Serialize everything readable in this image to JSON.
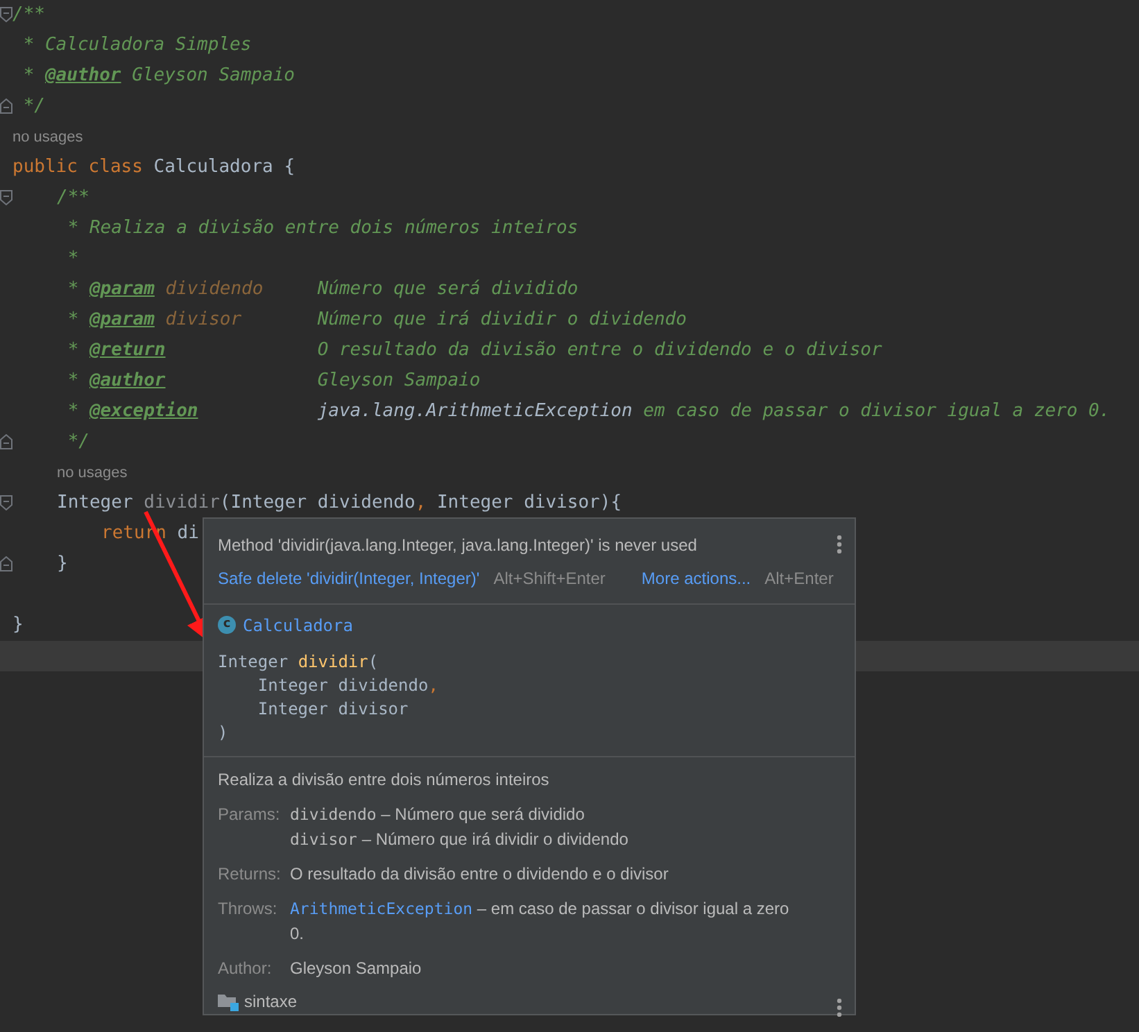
{
  "editor": {
    "lines": [
      {
        "kind": "doc_open",
        "text": "/**",
        "fold_start": true
      },
      {
        "kind": "doc_text",
        "text": "* Calculadora Simples"
      },
      {
        "kind": "doc_tag",
        "lead": "*",
        "tag": "@author",
        "description": "Gleyson Sampaio",
        "inline": true
      },
      {
        "kind": "doc_close",
        "text": "*/",
        "fold_end": true
      },
      {
        "kind": "hint",
        "text": "no usages"
      },
      {
        "kind": "code",
        "tokens": [
          {
            "text": "public",
            "kind": "keyword"
          },
          {
            "text": "class",
            "kind": "keyword"
          },
          {
            "text": "Calculadora",
            "kind": "class"
          },
          {
            "text": "{",
            "kind": "plain"
          }
        ],
        "children": [
          {
            "kind": "doc_open",
            "text": "/**",
            "fold_start": true
          },
          {
            "kind": "doc_text",
            "text": "* Realiza a divisão entre dois números inteiros"
          },
          {
            "kind": "doc_text",
            "text": "*"
          },
          {
            "kind": "doc_tag",
            "lead": "*",
            "tag": "@param",
            "name": "dividendo",
            "description": "Número que será dividido"
          },
          {
            "kind": "doc_tag",
            "lead": "*",
            "tag": "@param",
            "name": "divisor",
            "description": "Número que irá dividir o dividendo"
          },
          {
            "kind": "doc_tag",
            "lead": "*",
            "tag": "@return",
            "description": "O resultado da divisão entre o dividendo e o divisor"
          },
          {
            "kind": "doc_tag",
            "lead": "*",
            "tag": "@author",
            "description": "Gleyson Sampaio"
          },
          {
            "kind": "doc_tag",
            "lead": "*",
            "tag": "@exception",
            "ref": "java.lang.ArithmeticException",
            "description": "em caso de passar o divisor igual a zero 0."
          },
          {
            "kind": "doc_close",
            "text": "*/",
            "fold_end": true
          },
          {
            "kind": "hint",
            "text": "no usages"
          },
          {
            "kind": "code",
            "fold_start": true,
            "tokens": [
              {
                "text": "Integer",
                "kind": "plain"
              },
              {
                "text": "dividir",
                "kind": "unused"
              },
              {
                "text": "(Integer dividendo",
                "kind": "plain",
                "join": true
              },
              {
                "text": ",",
                "kind": "punct",
                "join": true
              },
              {
                "text": "Integer divisor){",
                "kind": "plain"
              }
            ],
            "children": [
              {
                "kind": "code",
                "tokens": [
                  {
                    "text": "return",
                    "kind": "keyword"
                  },
                  {
                    "text": "di",
                    "kind": "plain"
                  }
                ]
              }
            ]
          },
          {
            "kind": "code",
            "fold_end": true,
            "tokens": [
              {
                "text": "}",
                "kind": "plain"
              }
            ]
          },
          {
            "kind": "blank"
          }
        ]
      },
      {
        "kind": "code",
        "tokens": [
          {
            "text": "}",
            "kind": "plain"
          }
        ]
      },
      {
        "kind": "blank",
        "current": true
      }
    ]
  },
  "popup": {
    "message": "Method 'dividir(java.lang.Integer, java.lang.Integer)' is never used",
    "actions": [
      {
        "label": "Safe delete 'dividir(Integer, Integer)'",
        "shortcut": "Alt+Shift+Enter"
      },
      {
        "label": "More actions...",
        "shortcut": "Alt+Enter"
      }
    ],
    "class_icon": "c",
    "class_name": "Calculadora",
    "signature": {
      "return_type": "Integer",
      "name": "dividir",
      "open": "(",
      "params": [
        {
          "type": "Integer",
          "name": "dividendo",
          "separator": ","
        },
        {
          "type": "Integer",
          "name": "divisor"
        }
      ],
      "close": ")"
    },
    "description": "Realiza a divisão entre dois números inteiros",
    "sections": [
      {
        "label": "Params:",
        "entries": [
          {
            "code": "dividendo",
            "text": "– Número que será dividido"
          },
          {
            "code": "divisor",
            "text": "– Número que irá dividir o dividendo"
          }
        ]
      },
      {
        "label": "Returns:",
        "entries": [
          {
            "text": "O resultado da divisão entre o dividendo e o divisor"
          }
        ]
      },
      {
        "label": "Throws:",
        "entries": [
          {
            "link": "ArithmeticException",
            "text": "– em caso de passar o divisor igual a zero 0."
          }
        ]
      },
      {
        "label": "Author:",
        "entries": [
          {
            "text": "Gleyson Sampaio"
          }
        ]
      }
    ],
    "module": "sintaxe"
  }
}
